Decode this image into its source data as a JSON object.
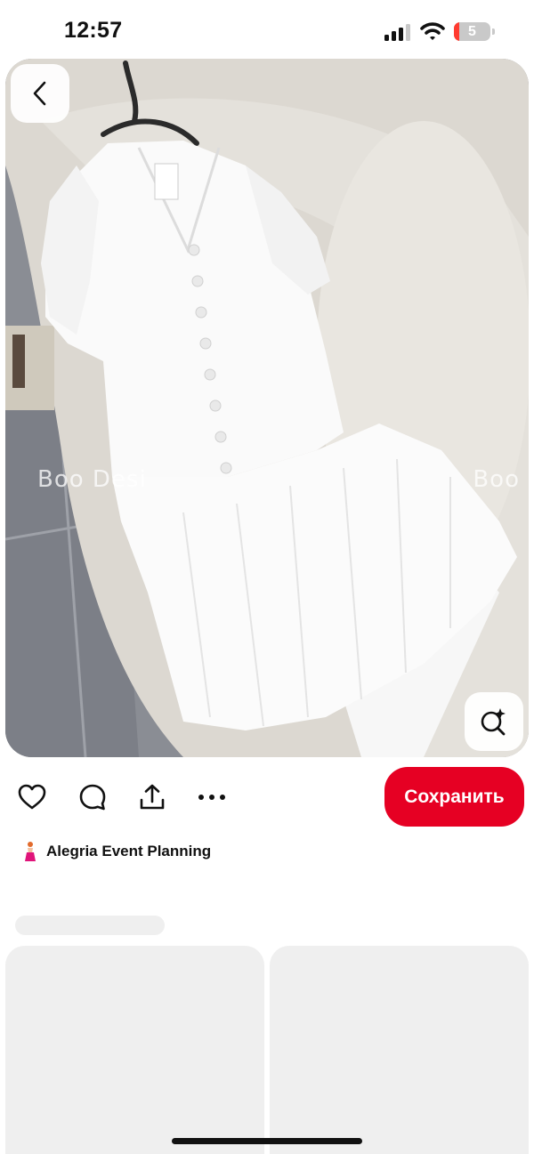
{
  "status_bar": {
    "time": "12:57",
    "battery_level": "5",
    "battery_color": "#ff3b30"
  },
  "pin": {
    "watermark_left": "Boo Desi",
    "watermark_right": "Boo",
    "back_icon": "chevron-left-icon",
    "visual_search_icon": "lens-sparkle-icon"
  },
  "actions": {
    "like_icon": "heart-icon",
    "comment_icon": "comment-bubble-icon",
    "share_icon": "share-upload-icon",
    "more_icon": "more-dots-icon",
    "save_label": "Сохранить",
    "save_color": "#e60023"
  },
  "creator": {
    "name": "Alegria Event Planning",
    "avatar_icon": "creator-avatar-icon"
  }
}
